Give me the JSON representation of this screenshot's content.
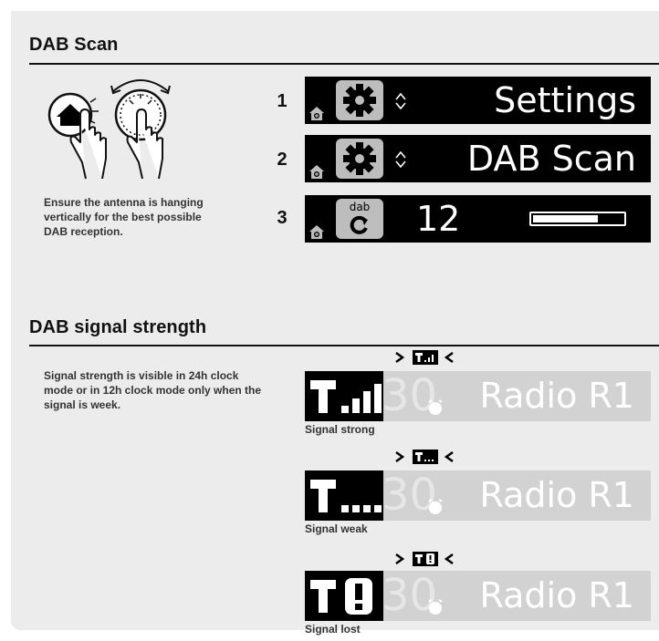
{
  "scan": {
    "title": "DAB Scan",
    "antenna_note": "Ensure the antenna is hanging vertically for the best possible DAB reception.",
    "steps": [
      {
        "number": "1",
        "icon": "gear-icon",
        "text": "Settings"
      },
      {
        "number": "2",
        "icon": "gear-icon",
        "text": "DAB Scan"
      },
      {
        "number": "3",
        "icon": "dab-scan-icon",
        "icon_text": "dab",
        "text": "12",
        "progress": 0.72
      }
    ]
  },
  "signal": {
    "title": "DAB signal strength",
    "note": "Signal strength is visible in 24h clock mode or in 12h clock mode only when the signal is week.",
    "ghost_digits": "30",
    "panels": [
      {
        "caption": "Signal strong",
        "station": "Radio R1",
        "level": "strong"
      },
      {
        "caption": "Signal weak",
        "station": "Radio R1",
        "level": "weak"
      },
      {
        "caption": "Signal lost",
        "station": "Radio R1",
        "level": "lost"
      }
    ]
  },
  "colors": {
    "panel_bg": "#ececec",
    "lcd_bg": "#000000",
    "icon_box": "#bdbdbd",
    "signal_bg": "#d2d2d2"
  }
}
